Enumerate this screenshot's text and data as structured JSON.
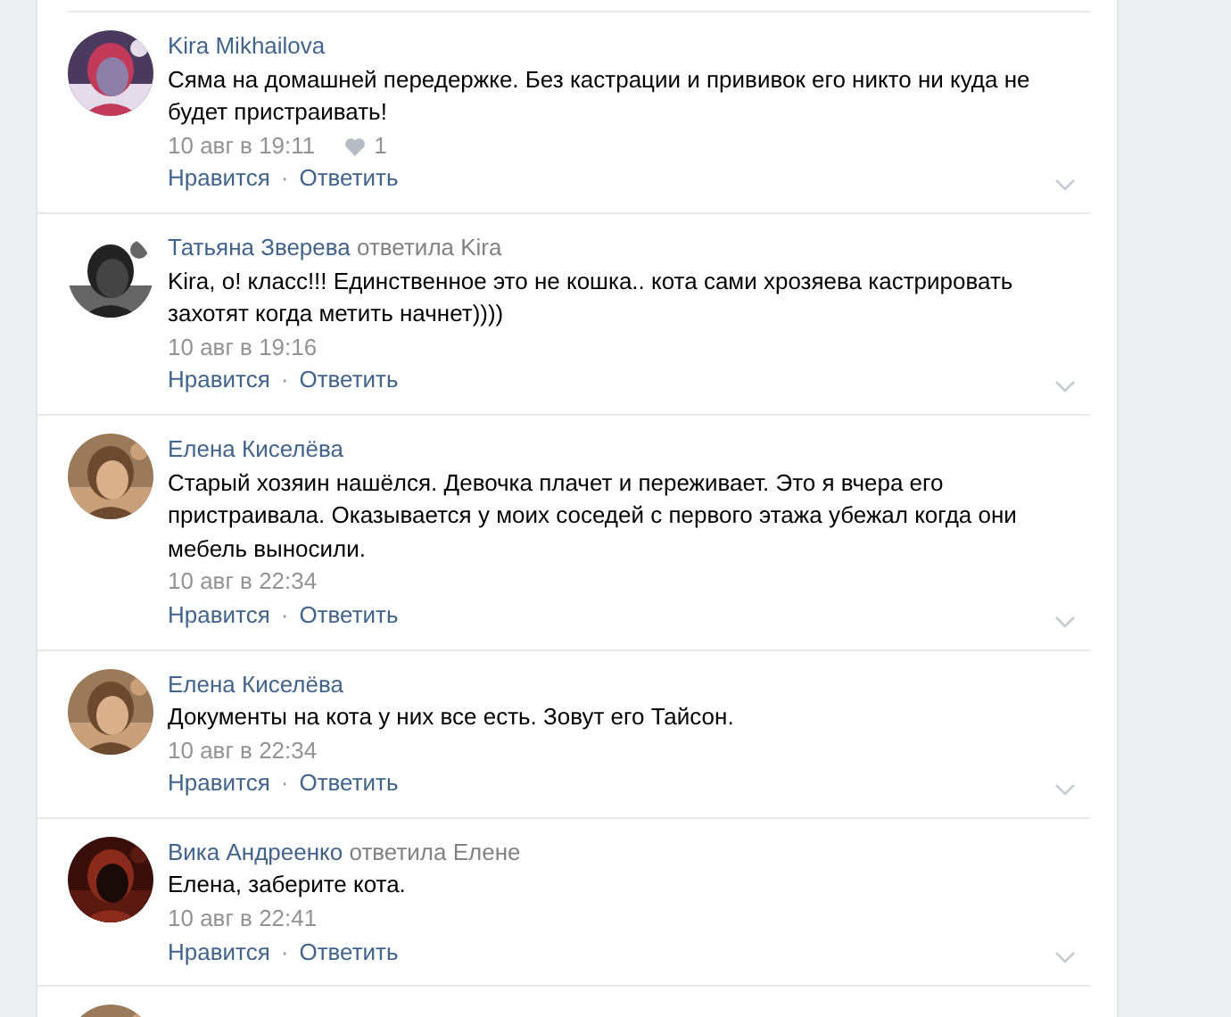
{
  "comments": [
    {
      "avatar": {
        "kind": "picture"
      },
      "author": "Kira Mikhailova",
      "text": "Сяма на домашней передержке. Без кастрации и прививок его никто ни куда не будет пристраивать!",
      "date": "10 авг в 19:11",
      "likes": "1",
      "actions": [
        "Нравится",
        "·",
        "Ответить"
      ]
    },
    {
      "avatar": {
        "kind": "picture"
      },
      "author": "Татьяна Зверева",
      "reply_to": "ответила Kira",
      "text": "Kira, о! класс!!! Единственное это не кошка.. кота сами хрозяева кастрировать захотят когда метить начнет))))",
      "date": "10 авг в 19:16",
      "actions": [
        "Нравится",
        "·",
        "Ответить"
      ]
    },
    {
      "avatar": {
        "kind": "picture"
      },
      "author": "Елена Киселёва",
      "text": "Старый хозяин нашёлся. Девочка плачет и переживает. Это я вчера его пристраивала. Оказывается у моих соседей с первого этажа убежал когда они мебель выносили.",
      "date": "10 авг в 22:34",
      "actions": [
        "Нравится",
        "·",
        "Ответить"
      ]
    },
    {
      "avatar": {
        "kind": "picture"
      },
      "author": "Елена Киселёва",
      "text": "Документы на кота у них все есть. Зовут его Тайсон.",
      "date": "10 авг в 22:34",
      "actions": [
        "Нравится",
        "·",
        "Ответить"
      ]
    },
    {
      "avatar": {
        "kind": "picture"
      },
      "author": "Вика Андреенко",
      "reply_to": "ответила Елене",
      "text": "Елена, заберите кота.",
      "date": "10 авг в 22:41",
      "actions": [
        "Нравится",
        "·",
        "Ответить"
      ]
    },
    {
      "avatar": {
        "kind": "picture"
      }
    }
  ]
}
